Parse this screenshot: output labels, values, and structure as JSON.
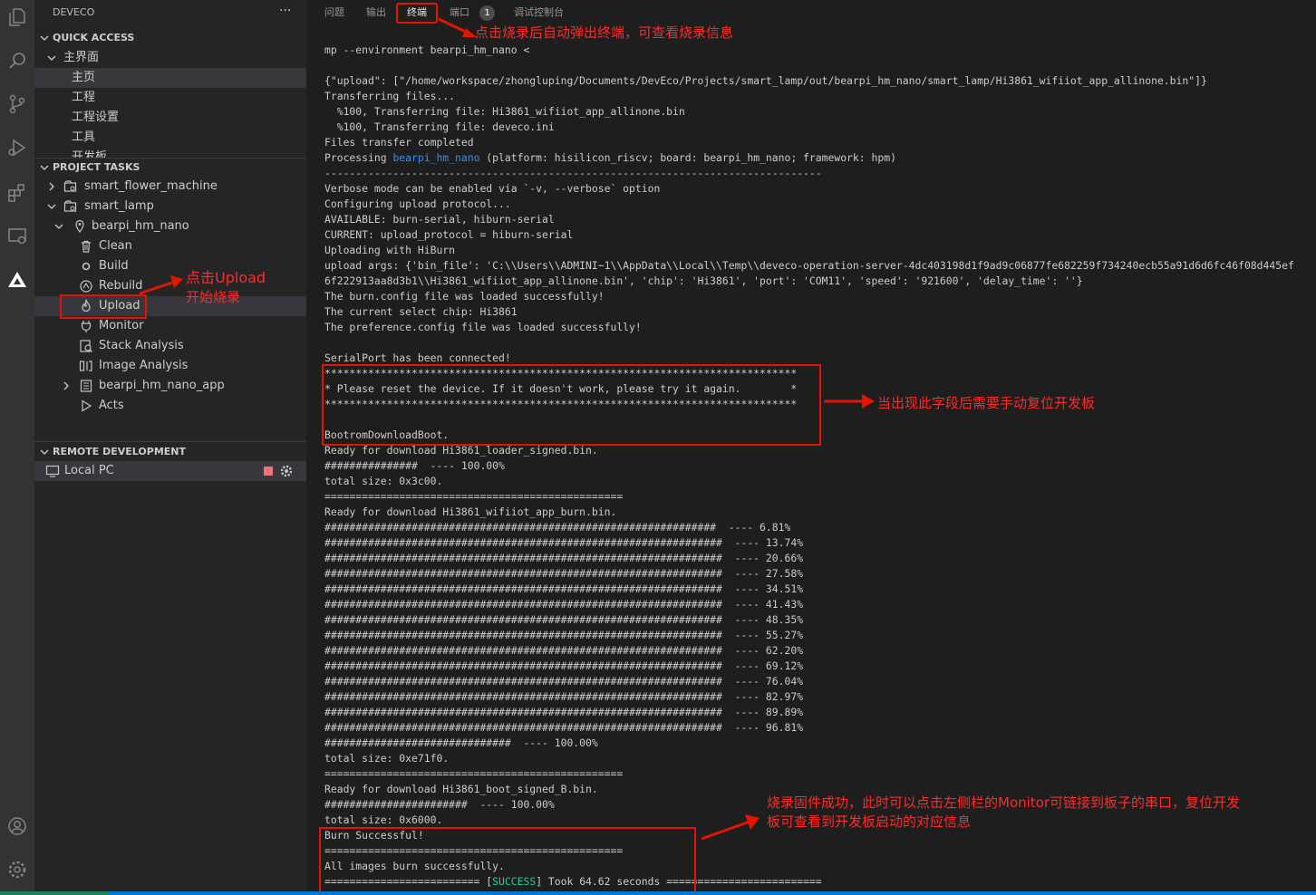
{
  "activity_bar": {
    "top_icons": [
      "files-icon",
      "search-icon",
      "source-control-icon",
      "run-debug-icon",
      "extensions-icon",
      "remote-explorer-icon",
      "deveco-logo-icon"
    ],
    "bottom_icons": [
      "account-icon",
      "settings-gear-icon"
    ]
  },
  "sidebar": {
    "title": "DEVECO",
    "more_label": "···",
    "quick_access": {
      "header": "QUICK ACCESS",
      "group": "主界面",
      "items": [
        "主页",
        "工程",
        "工程设置",
        "工具",
        "开发板"
      ]
    },
    "project_tasks": {
      "header": "PROJECT TASKS",
      "projects": [
        "smart_flower_machine",
        "smart_lamp"
      ],
      "board": "bearpi_hm_nano",
      "tasks": [
        "Clean",
        "Build",
        "Rebuild",
        "Upload",
        "Monitor",
        "Stack Analysis",
        "Image Analysis"
      ],
      "app": "bearpi_hm_nano_app",
      "acts": "Acts"
    },
    "remote_development": {
      "header": "REMOTE DEVELOPMENT",
      "item": "Local PC"
    }
  },
  "panel": {
    "tabs": [
      "问题",
      "输出",
      "终端",
      "端口",
      "调试控制台"
    ],
    "active_tab": "终端",
    "ports_badge": "1"
  },
  "terminal": {
    "lines": [
      "mp --environment bearpi_hm_nano <",
      "",
      "{\"upload\": [\"/home/workspace/zhongluping/Documents/DevEco/Projects/smart_lamp/out/bearpi_hm_nano/smart_lamp/Hi3861_wifiiot_app_allinone.bin\"]}",
      "Transferring files...",
      "  %100, Transferring file: Hi3861_wifiiot_app_allinone.bin",
      "  %100, Transferring file: deveco.ini",
      "Files transfer completed",
      "Processing |bearpi_hm_nano| (platform: hisilicon_riscv; board: bearpi_hm_nano; framework: hpm)",
      "--------------------------------------------------------------------------------",
      "Verbose mode can be enabled via `-v, --verbose` option",
      "Configuring upload protocol...",
      "AVAILABLE: burn-serial, hiburn-serial",
      "CURRENT: upload_protocol = hiburn-serial",
      "Uploading with HiBurn",
      "upload args: {'bin_file': 'C:\\\\Users\\\\ADMINI~1\\\\AppData\\\\Local\\\\Temp\\\\deveco-operation-server-4dc403198d1f9ad9c06877fe682259f734240ecb55a91d6d6fc46f08d445ef",
      "6f222913aa8d3b1\\\\Hi3861_wifiiot_app_allinone.bin', 'chip': 'Hi3861', 'port': 'COM11', 'speed': '921600', 'delay_time': ''}",
      "The burn.config file was loaded successfully!",
      "The current select chip: Hi3861",
      "The preference.config file was loaded successfully!",
      "",
      "SerialPort has been connected!",
      "****************************************************************************",
      "* Please reset the device. If it doesn't work, please try it again.        *",
      "****************************************************************************",
      "",
      "BootromDownloadBoot.",
      "Ready for download Hi3861_loader_signed.bin.",
      "###############  ---- 100.00%",
      "total size: 0x3c00.",
      "================================================",
      "Ready for download Hi3861_wifiiot_app_burn.bin.",
      "###############################################################  ---- 6.81%",
      "################################################################  ---- 13.74%",
      "################################################################  ---- 20.66%",
      "################################################################  ---- 27.58%",
      "################################################################  ---- 34.51%",
      "################################################################  ---- 41.43%",
      "################################################################  ---- 48.35%",
      "################################################################  ---- 55.27%",
      "################################################################  ---- 62.20%",
      "################################################################  ---- 69.12%",
      "################################################################  ---- 76.04%",
      "################################################################  ---- 82.97%",
      "################################################################  ---- 89.89%",
      "################################################################  ---- 96.81%",
      "##############################  ---- 100.00%",
      "total size: 0xe71f0.",
      "================================================",
      "Ready for download Hi3861_boot_signed_B.bin.",
      "#######################  ---- 100.00%",
      "total size: 0x6000.",
      "Burn Successful!",
      "================================================",
      "All images burn successfully.",
      "========================= [|SUCCESS|] Took 64.62 seconds ========================="
    ]
  },
  "annotations": {
    "tab_note": "点击烧录后自动弹出终端，可查看烧录信息",
    "upload_note_1": "点击Upload",
    "upload_note_2": "开始烧录",
    "reset_note": "当出现此字段后需要手动复位开发板",
    "success_note_1": "烧录固件成功，此时可以点击左侧栏的Monitor可链接到板子的串口，复位开发",
    "success_note_2": "板可查看到开发板启动的对应信息"
  },
  "colors": {
    "annotation_red": "#e51400",
    "link_blue": "#3b8eea",
    "success_green": "#23d18b"
  }
}
